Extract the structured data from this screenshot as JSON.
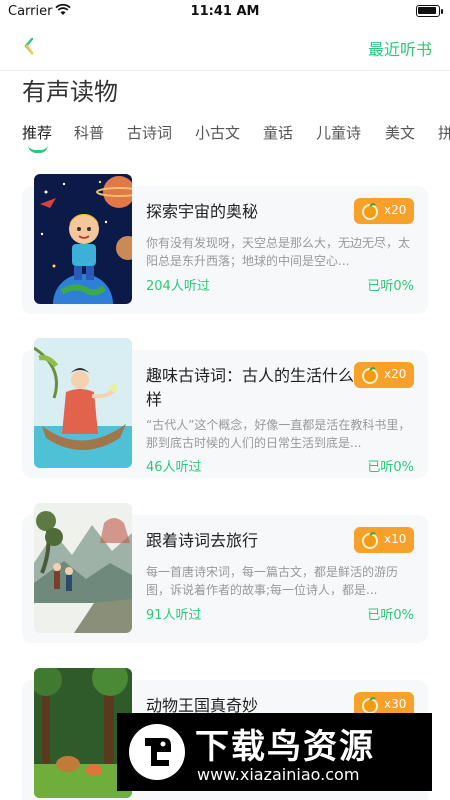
{
  "status_bar": {
    "carrier": "Carrier",
    "time": "11:41 AM"
  },
  "nav": {
    "recent_label": "最近听书"
  },
  "page": {
    "title": "有声读物"
  },
  "tabs": [
    "推荐",
    "科普",
    "古诗词",
    "小古文",
    "童话",
    "儿童诗",
    "美文",
    "拼"
  ],
  "active_tab_index": 0,
  "books": [
    {
      "title": "探索宇宙的奥秘",
      "price": "x20",
      "description": "你有没有发现呀，天空总是那么大，无边无尽，太阳总是东升西落；地球的中间是空心...",
      "listeners": "204人听过",
      "progress": "已听0%"
    },
    {
      "title": "趣味古诗词：古人的生活什么样",
      "price": "x20",
      "description": "“古代人”这个概念，好像一直都是活在教科书里，那到底古时候的人们的日常生活到底是...",
      "listeners": "46人听过",
      "progress": "已听0%"
    },
    {
      "title": "跟着诗词去旅行",
      "price": "x10",
      "description": "每一首唐诗宋词，每一篇古文，都是鲜活的游历图，诉说着作者的故事;每一位诗人，都是...",
      "listeners": "91人听过",
      "progress": "已听0%"
    },
    {
      "title": "动物王国真奇妙",
      "price": "x30"
    }
  ],
  "watermark": {
    "title": "下载鸟资源",
    "url": "www.xiazainiao.com"
  },
  "colors": {
    "accent": "#2fc87a",
    "price_badge": "#f7a12a",
    "card_bg": "#f6f8fa"
  }
}
